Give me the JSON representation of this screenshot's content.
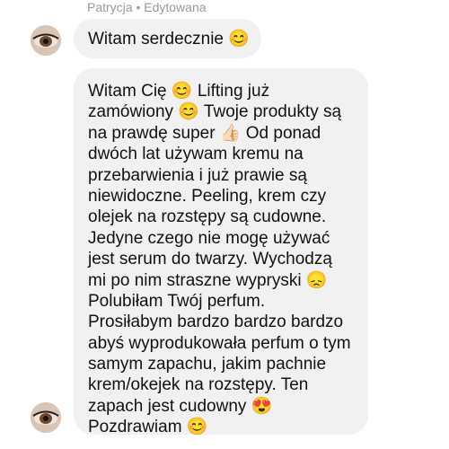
{
  "sender": {
    "name_line": "Patrycja • Edytowana"
  },
  "messages": [
    {
      "lines": [
        "Witam serdecznie 😊"
      ]
    },
    {
      "lines": [
        "Witam Cię 😊 Lifting już",
        "zamówiony 😊 Twoje produkty są",
        "na prawdę super 👍🏻 Od ponad",
        "dwóch lat używam kremu na",
        "przebarwienia i już prawie są",
        "niewidoczne. Peeling, krem czy",
        "olejek na rozstępy są cudowne.",
        "Jedyne czego nie mogę używać",
        "jest serum do twarzy. Wychodzą",
        "mi po nim straszne wypryski 😞",
        "Polubiłam Twój perfum.",
        "Prosiłabym bardzo bardzo bardzo",
        "abyś wyprodukowała perfum o tym",
        "samym zapachu, jakim pachnie",
        "krem/okejek na rozstępy. Ten",
        "zapach jest cudowny 😍",
        "Pozdrawiam 😊"
      ]
    }
  ],
  "avatar_icon": "profile-photo"
}
